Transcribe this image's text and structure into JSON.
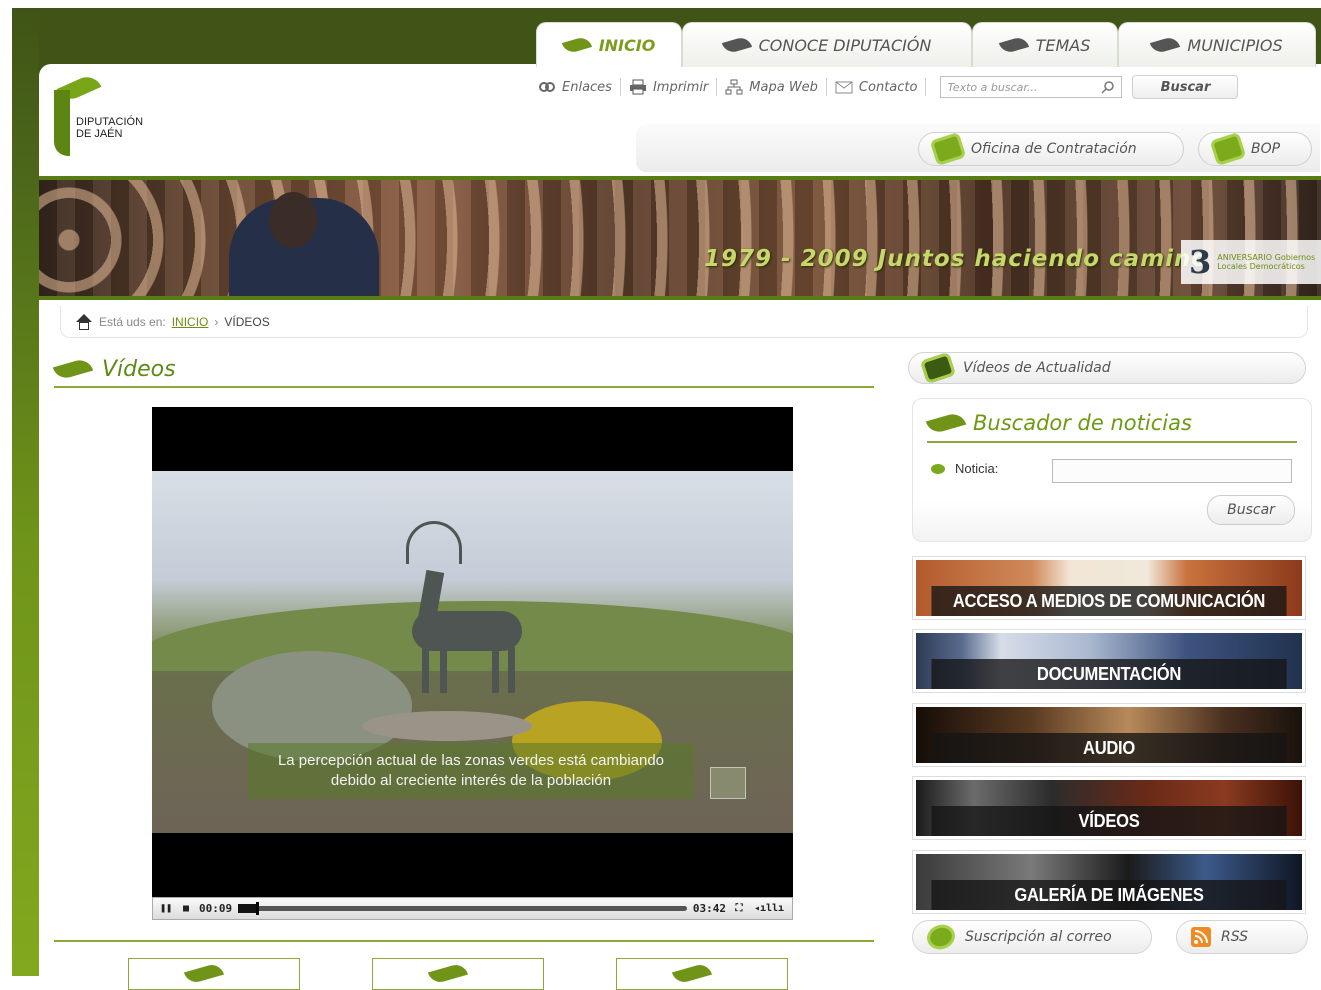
{
  "nav": {
    "tabs": [
      {
        "label": "INICIO",
        "active": true
      },
      {
        "label": "CONOCE DIPUTACIÓN",
        "active": false
      },
      {
        "label": "TEMAS",
        "active": false
      },
      {
        "label": "MUNICIPIOS",
        "active": false
      }
    ]
  },
  "logo": {
    "line1": "DIPUTACIÓN",
    "line2": "DE JAÉN"
  },
  "utility": {
    "links": [
      "Enlaces",
      "Imprimir",
      "Mapa Web",
      "Contacto"
    ],
    "search_placeholder": "Texto a buscar...",
    "search_button": "Buscar"
  },
  "subbar": {
    "contratacion": "Oficina de Contratación",
    "bop": "BOP"
  },
  "banner": {
    "title": "1979 - 2009 Juntos haciendo camino",
    "badge_number": "3",
    "badge_text": "ANIVERSARIO Gobiernos Locales Democráticos"
  },
  "breadcrumb": {
    "prefix": "Está uds en:",
    "home": "INICIO",
    "separator": "›",
    "current": "VÍDEOS"
  },
  "section_title": "Vídeos",
  "video": {
    "subtitle_line1": "La percepción actual de las zonas verdes está cambiando",
    "subtitle_line2": "debido al creciente interés de la población",
    "current_time": "00:09",
    "duration": "03:42",
    "progress": 0.04
  },
  "sidebar": {
    "actualidad": "Vídeos de Actualidad",
    "buscador_title": "Buscador de noticias",
    "noticia_label": "Noticia:",
    "buscar_button": "Buscar",
    "blocks": [
      "ACCESO A MEDIOS DE COMUNICACIÓN",
      "DOCUMENTACIÓN",
      "AUDIO",
      "VÍDEOS",
      "GALERÍA DE IMÁGENES"
    ],
    "suscripcion": "Suscripción al correo",
    "rss": "RSS"
  },
  "colors": {
    "brand_green": "#6c9a13",
    "dark_green": "#3f5416"
  }
}
